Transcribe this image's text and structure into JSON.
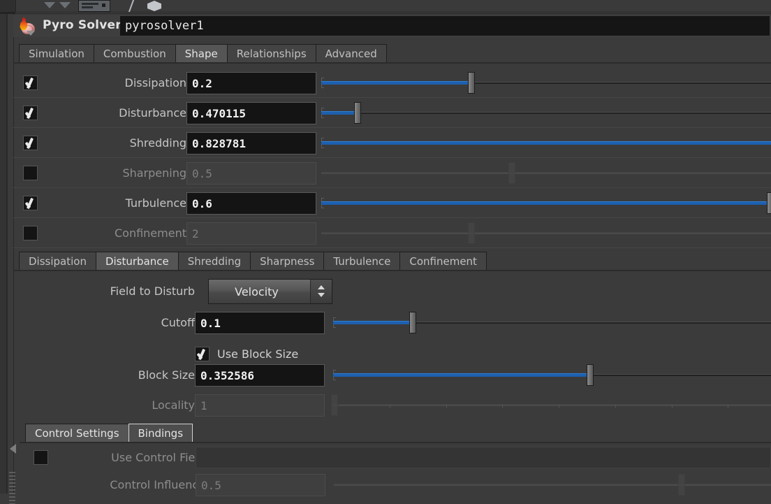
{
  "toolbar": {
    "icons": [
      "chevron-down-icon",
      "panel-icon",
      "slash-icon",
      "cube-icon"
    ]
  },
  "node_header": {
    "icon": "pyro-flame-brain-icon",
    "title": "Pyro Solver",
    "name_value": "pyrosolver1"
  },
  "main_tabs": {
    "items": [
      {
        "label": "Simulation",
        "active": false
      },
      {
        "label": "Combustion",
        "active": false
      },
      {
        "label": "Shape",
        "active": true
      },
      {
        "label": "Relationships",
        "active": false
      },
      {
        "label": "Advanced",
        "active": false
      }
    ]
  },
  "shape_params": {
    "rows": [
      {
        "label": "Dissipation",
        "value": "0.2",
        "checked": true,
        "enabled": true,
        "fill_pct": 32.5,
        "handle_pct": 32.5
      },
      {
        "label": "Disturbance",
        "value": "0.470115",
        "checked": true,
        "enabled": true,
        "fill_pct": 7.8,
        "handle_pct": 7.8
      },
      {
        "label": "Shredding",
        "value": "0.828781",
        "checked": true,
        "enabled": true,
        "fill_pct": 100,
        "handle_pct": 100
      },
      {
        "label": "Sharpening",
        "value": "0.5",
        "checked": false,
        "enabled": false,
        "fill_pct": 0,
        "handle_pct": 41.2
      },
      {
        "label": "Turbulence",
        "value": "0.6",
        "checked": true,
        "enabled": true,
        "fill_pct": 97.0,
        "handle_pct": 97.0
      },
      {
        "label": "Confinement",
        "value": "2",
        "checked": false,
        "enabled": false,
        "fill_pct": 0,
        "handle_pct": 32.4
      }
    ]
  },
  "shape_tabs": {
    "items": [
      {
        "label": "Dissipation",
        "state": "normal"
      },
      {
        "label": "Disturbance",
        "state": "active"
      },
      {
        "label": "Shredding",
        "state": "normal"
      },
      {
        "label": "Sharpness",
        "state": "normal"
      },
      {
        "label": "Turbulence",
        "state": "normal"
      },
      {
        "label": "Confinement",
        "state": "normal"
      }
    ]
  },
  "disturbance": {
    "field_to_disturb": {
      "label": "Field to Disturb",
      "value": "Velocity"
    },
    "cutoff": {
      "label": "Cutoff",
      "value": "0.1",
      "enabled": true,
      "fill_pct": 17.6,
      "handle_pct": 17.6
    },
    "use_block_size": {
      "label": "Use Block Size",
      "checked": true
    },
    "block_size": {
      "label": "Block Size",
      "value": "0.352586",
      "enabled": true,
      "fill_pct": 57.0,
      "handle_pct": 57.0
    },
    "locality": {
      "label": "Locality",
      "value": "1",
      "enabled": false,
      "fill_pct": 0,
      "handle_pct": 0.3
    }
  },
  "bottom_tabs": {
    "items": [
      {
        "label": "Control Settings",
        "state": "active"
      },
      {
        "label": "Bindings",
        "state": "hover"
      }
    ]
  },
  "control_settings": {
    "use_control_field": {
      "label": "Use Control Field",
      "checked": false,
      "enabled": false
    },
    "control_influence": {
      "label": "Control Influence",
      "value": "0.5",
      "enabled": false,
      "handle_pct": 79.5
    }
  },
  "colors": {
    "panel_bg": "#3b3b3b",
    "field_bg": "#141414",
    "slider_fill": "#1d5fae",
    "tab_active": "#555555",
    "text": "#c8c8c8"
  }
}
